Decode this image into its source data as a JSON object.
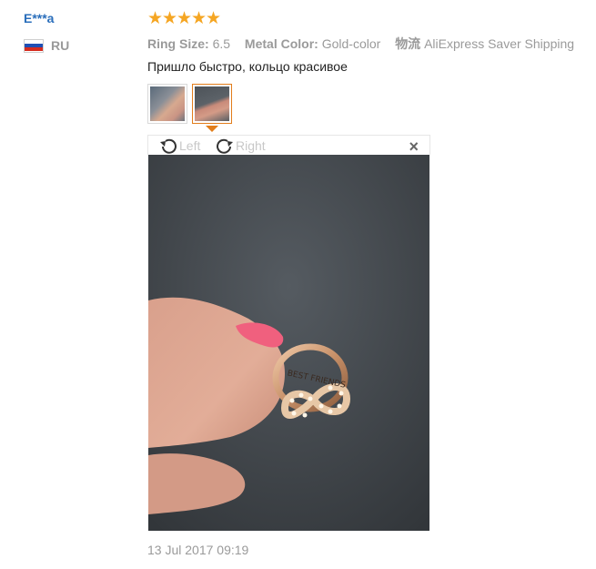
{
  "user": {
    "name": "E***a",
    "country": "RU",
    "flag_colors": [
      "#ffffff",
      "#1f4fb4",
      "#d52b1e"
    ]
  },
  "review": {
    "rating": 5,
    "star_color": "#f5a623",
    "attributes": [
      {
        "label": "Ring Size:",
        "value": "6.5"
      },
      {
        "label": "Metal Color:",
        "value": "Gold-color"
      },
      {
        "label": "物流",
        "value": "AliExpress Saver Shipping"
      }
    ],
    "text": "Пришло быстро, кольцо красивое",
    "photos": [
      {
        "name": "photo-1",
        "active": false
      },
      {
        "name": "photo-2",
        "active": true
      }
    ],
    "viewer": {
      "rotate_left_label": "Left",
      "rotate_right_label": "Right",
      "close_symbol": "×"
    },
    "photo_ring_text": "BEST FRIENDS",
    "date": "13 Jul 2017 09:19"
  },
  "colors": {
    "link_blue": "#2a6ebb",
    "accent_orange": "#e27d1b",
    "muted_gray": "#9a9a9a"
  }
}
